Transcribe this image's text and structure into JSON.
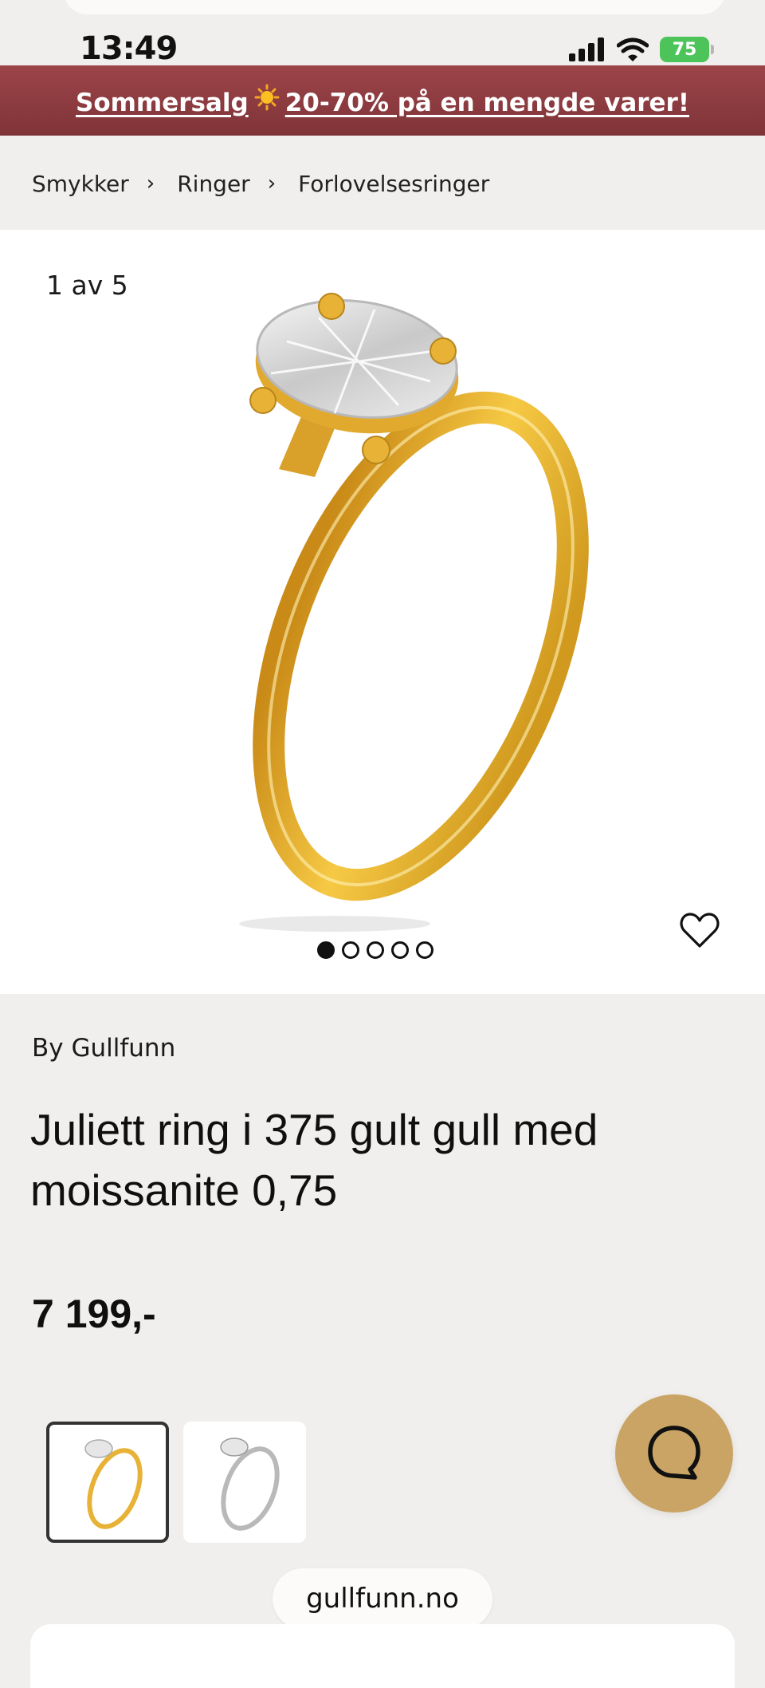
{
  "status_bar": {
    "time": "13:49",
    "battery": "75"
  },
  "promo_banner": {
    "text_before": "Sommersalg",
    "text_after": "20-70% på en mengde varer!",
    "icon": "sun-icon"
  },
  "breadcrumb": [
    "Smykker",
    "Ringer",
    "Forlovelsesringer"
  ],
  "gallery": {
    "counter": "1 av 5",
    "total_images": 5,
    "active_index": 0
  },
  "product": {
    "brand": "By Gullfunn",
    "title": "Juliett ring i 375 gult gull med moissanite 0,75",
    "price": "7 199,-"
  },
  "variants": [
    {
      "metal": "gold",
      "selected": true
    },
    {
      "metal": "silver",
      "selected": false
    }
  ],
  "browser": {
    "url": "gullfunn.no"
  },
  "colors": {
    "banner": "#8c3b40",
    "chat_button": "#caa465",
    "page_bg": "#f1efed",
    "gold": "#e7b235"
  }
}
